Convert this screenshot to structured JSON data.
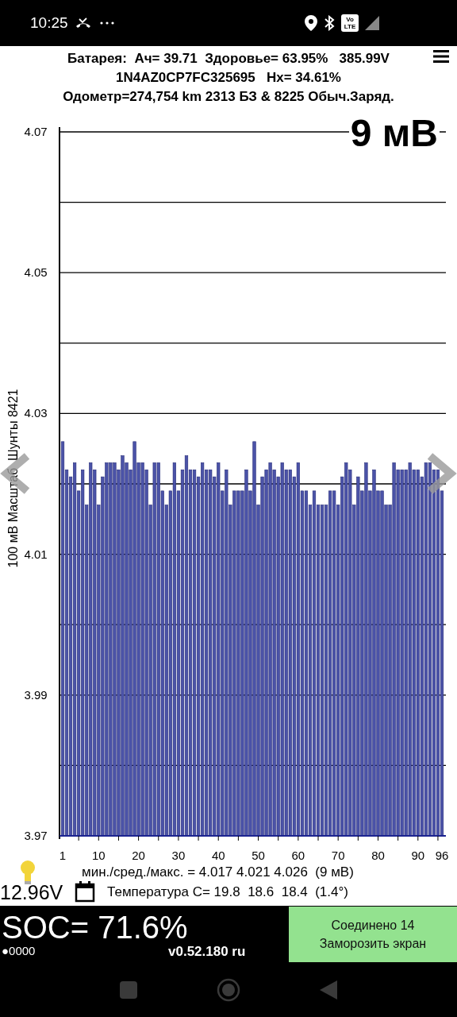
{
  "status_bar": {
    "time": "10:25",
    "volte_top": "Vo",
    "volte_bottom": "LTE"
  },
  "header": {
    "line_1": "Батарея:  Ач= 39.71  Здоровье= 63.95%   385.99V",
    "line_2": "1N4AZ0CP7FC325695   Hx= 34.61%",
    "line_3": "Одометр=274,754 km 2313 БЗ & 8225 Обыч.Заряд."
  },
  "spread_label": "9 мВ",
  "chart": {
    "chart_data": {
      "type": "bar",
      "ylabel": "100 мВ Масштаб  Шунты 8421",
      "ylim": [
        3.97,
        4.07
      ],
      "yticks": [
        {
          "value": 3.97,
          "label": "3.97"
        },
        {
          "value": 3.99,
          "label": "3.99"
        },
        {
          "value": 4.01,
          "label": "4.01"
        },
        {
          "value": 4.03,
          "label": "4.03"
        },
        {
          "value": 4.05,
          "label": "4.05"
        },
        {
          "value": 4.07,
          "label": "4.07"
        }
      ],
      "grid": true,
      "x": [
        1,
        2,
        3,
        4,
        5,
        6,
        7,
        8,
        9,
        10,
        11,
        12,
        13,
        14,
        15,
        16,
        17,
        18,
        19,
        20,
        21,
        22,
        23,
        24,
        25,
        26,
        27,
        28,
        29,
        30,
        31,
        32,
        33,
        34,
        35,
        36,
        37,
        38,
        39,
        40,
        41,
        42,
        43,
        44,
        45,
        46,
        47,
        48,
        49,
        50,
        51,
        52,
        53,
        54,
        55,
        56,
        57,
        58,
        59,
        60,
        61,
        62,
        63,
        64,
        65,
        66,
        67,
        68,
        69,
        70,
        71,
        72,
        73,
        74,
        75,
        76,
        77,
        78,
        79,
        80,
        81,
        82,
        83,
        84,
        85,
        86,
        87,
        88,
        89,
        90,
        91,
        92,
        93,
        94,
        95,
        96
      ],
      "xlim": [
        1,
        96
      ],
      "xticks": [
        {
          "value": 1,
          "label": "1"
        },
        {
          "value": 10,
          "label": "10"
        },
        {
          "value": 20,
          "label": "20"
        },
        {
          "value": 30,
          "label": "30"
        },
        {
          "value": 40,
          "label": "40"
        },
        {
          "value": 50,
          "label": "50"
        },
        {
          "value": 60,
          "label": "60"
        },
        {
          "value": 70,
          "label": "70"
        },
        {
          "value": 80,
          "label": "80"
        },
        {
          "value": 90,
          "label": "90"
        },
        {
          "value": 96,
          "label": "96"
        }
      ],
      "series": [
        {
          "color": "#4b53a8",
          "values": [
            4.026,
            4.022,
            4.021,
            4.023,
            4.019,
            4.022,
            4.017,
            4.023,
            4.022,
            4.017,
            4.021,
            4.023,
            4.023,
            4.023,
            4.022,
            4.024,
            4.023,
            4.022,
            4.026,
            4.023,
            4.023,
            4.022,
            4.017,
            4.023,
            4.023,
            4.019,
            4.017,
            4.019,
            4.023,
            4.019,
            4.022,
            4.024,
            4.022,
            4.022,
            4.021,
            4.023,
            4.022,
            4.022,
            4.021,
            4.023,
            4.019,
            4.022,
            4.017,
            4.019,
            4.019,
            4.019,
            4.022,
            4.019,
            4.026,
            4.017,
            4.021,
            4.022,
            4.023,
            4.022,
            4.021,
            4.023,
            4.022,
            4.022,
            4.021,
            4.023,
            4.019,
            4.019,
            4.017,
            4.019,
            4.017,
            4.017,
            4.017,
            4.019,
            4.019,
            4.017,
            4.021,
            4.023,
            4.022,
            4.017,
            4.021,
            4.019,
            4.023,
            4.019,
            4.022,
            4.019,
            4.019,
            4.017,
            4.017,
            4.023,
            4.022,
            4.022,
            4.022,
            4.023,
            4.022,
            4.022,
            4.021,
            4.023,
            4.023,
            4.022,
            4.022,
            4.019
          ]
        }
      ]
    }
  },
  "stats": "мин./сред./макс. = 4.017 4.021 4.026  (9 мВ)",
  "aux_voltage": "12.96V",
  "temperature": "Температура C= 19.8  18.6  18.4  (1.4°)",
  "soc": "SOC= 71.6%",
  "indicator": "●0000",
  "version": "v0.52.180 ru",
  "connect_button": {
    "line_1": "Соединено 14",
    "line_2": "Заморозить экран"
  }
}
